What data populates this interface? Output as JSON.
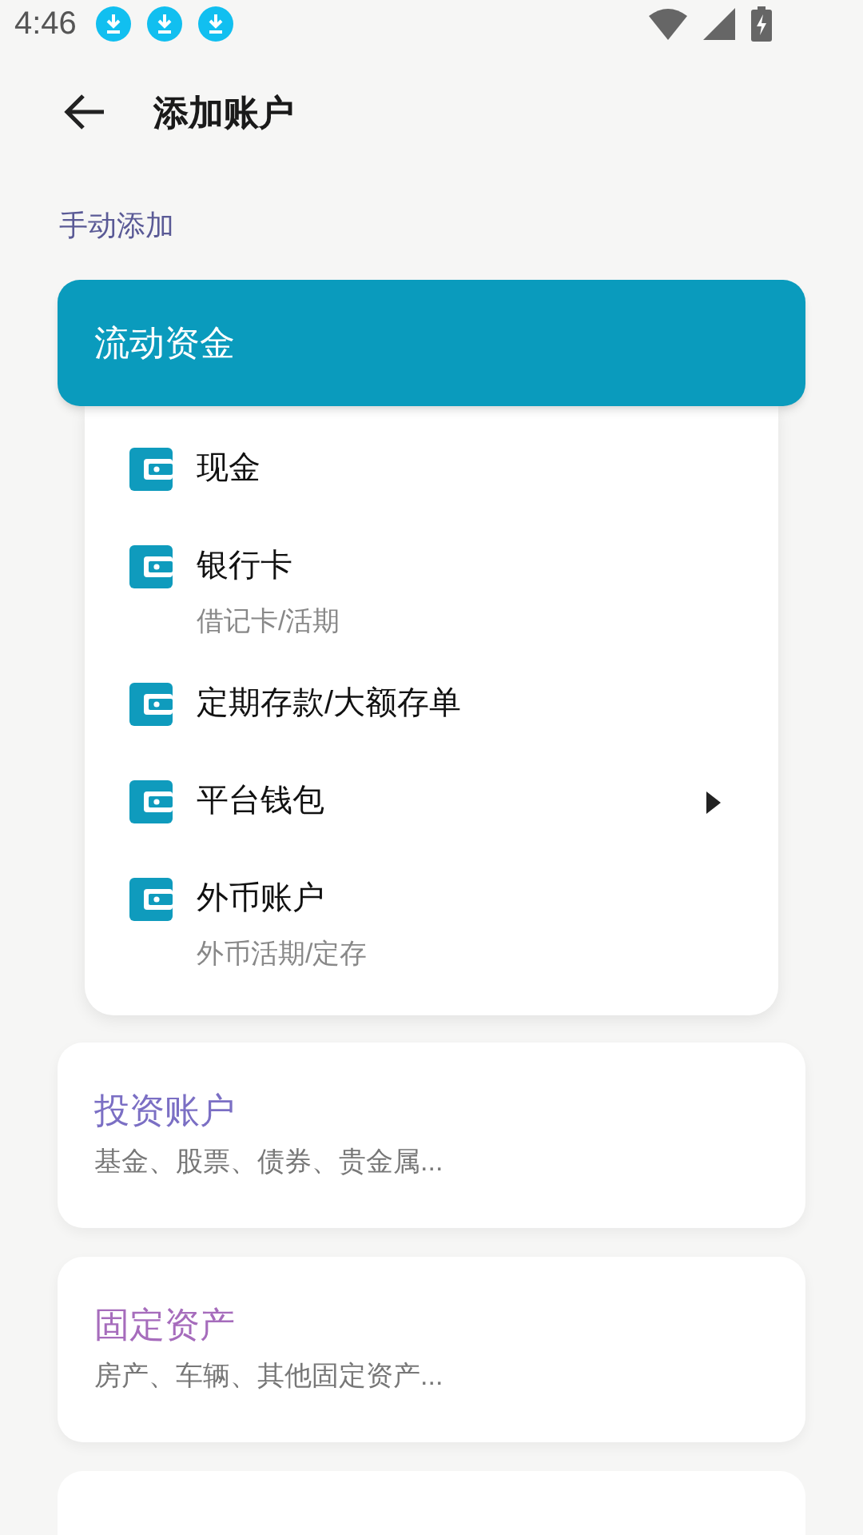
{
  "status_bar": {
    "time": "4:46",
    "notifications": [
      {
        "kind": "download"
      },
      {
        "kind": "download"
      },
      {
        "kind": "download"
      }
    ]
  },
  "header": {
    "title": "添加账户"
  },
  "section_label": "手动添加",
  "expanded_group": {
    "title": "流动资金",
    "expanded": true,
    "items": [
      {
        "title": "现金",
        "has_submenu": false
      },
      {
        "title": "银行卡",
        "subtitle": "借记卡/活期",
        "has_submenu": false
      },
      {
        "title": "定期存款/大额存单",
        "has_submenu": false
      },
      {
        "title": "平台钱包",
        "has_submenu": true
      },
      {
        "title": "外币账户",
        "subtitle": "外币活期/定存",
        "has_submenu": false
      }
    ]
  },
  "groups": [
    {
      "title": "投资账户",
      "subtitle": "基金、股票、债券、贵金属...",
      "color": "#7b6fc4"
    },
    {
      "title": "固定资产",
      "subtitle": "房产、车辆、其他固定资产...",
      "color": "#a66cbc"
    }
  ]
}
